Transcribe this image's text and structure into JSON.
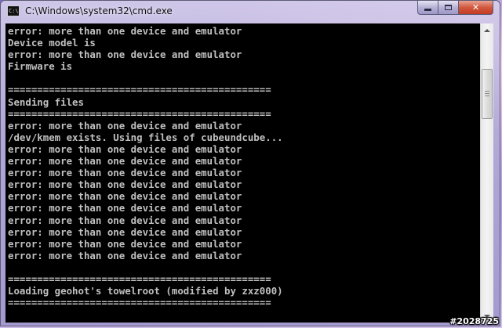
{
  "window": {
    "title": "C:\\Windows\\system32\\cmd.exe",
    "icon_label": "C:\\"
  },
  "console": {
    "lines": [
      "error: more than one device and emulator",
      "Device model is",
      "error: more than one device and emulator",
      "Firmware is",
      "",
      "=============================================",
      "Sending files",
      "=============================================",
      "error: more than one device and emulator",
      "/dev/kmem exists. Using files of cubeundcube...",
      "error: more than one device and emulator",
      "error: more than one device and emulator",
      "error: more than one device and emulator",
      "error: more than one device and emulator",
      "error: more than one device and emulator",
      "error: more than one device and emulator",
      "error: more than one device and emulator",
      "error: more than one device and emulator",
      "error: more than one device and emulator",
      "error: more than one device and emulator",
      "",
      "=============================================",
      "Loading geohot's towelroot (modified by zxz000)",
      "============================================="
    ]
  },
  "watermark": "#2028725",
  "colors": {
    "console_bg": "#000000",
    "console_fg": "#c0c0c0",
    "close_button": "#c23b22"
  },
  "icons": [
    "cmd-app-icon",
    "minimize-icon",
    "maximize-icon",
    "close-icon",
    "scroll-up-arrow-icon",
    "scroll-down-arrow-icon"
  ]
}
